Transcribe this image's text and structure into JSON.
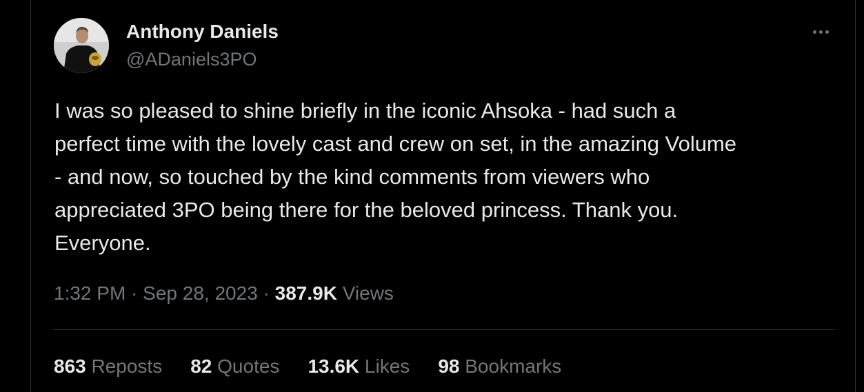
{
  "author": {
    "display_name": "Anthony Daniels",
    "handle": "@ADaniels3PO",
    "avatar_icon": "profile-photo"
  },
  "more_icon": "more-horizontal-icon",
  "tweet": {
    "text": "I was so pleased to shine briefly in the iconic Ahsoka - had such a\nperfect time with the lovely cast and crew on set, in the amazing Volume\n- and now, so touched by the kind comments from viewers who\nappreciated 3PO being there for the beloved princess. Thank you.\nEveryone."
  },
  "meta": {
    "time": "1:32 PM",
    "sep1": " · ",
    "date": "Sep 28, 2023",
    "sep2": " · ",
    "views_count": "387.9K",
    "views_label": " Views"
  },
  "stats": {
    "reposts": {
      "count": "863",
      "label": " Reposts"
    },
    "quotes": {
      "count": "82",
      "label": " Quotes"
    },
    "likes": {
      "count": "13.6K",
      "label": " Likes"
    },
    "bookmarks": {
      "count": "98",
      "label": " Bookmarks"
    }
  },
  "colors": {
    "background": "#000000",
    "primary_text": "#e7e9ea",
    "secondary_text": "#71767b",
    "border": "#2f3336"
  }
}
